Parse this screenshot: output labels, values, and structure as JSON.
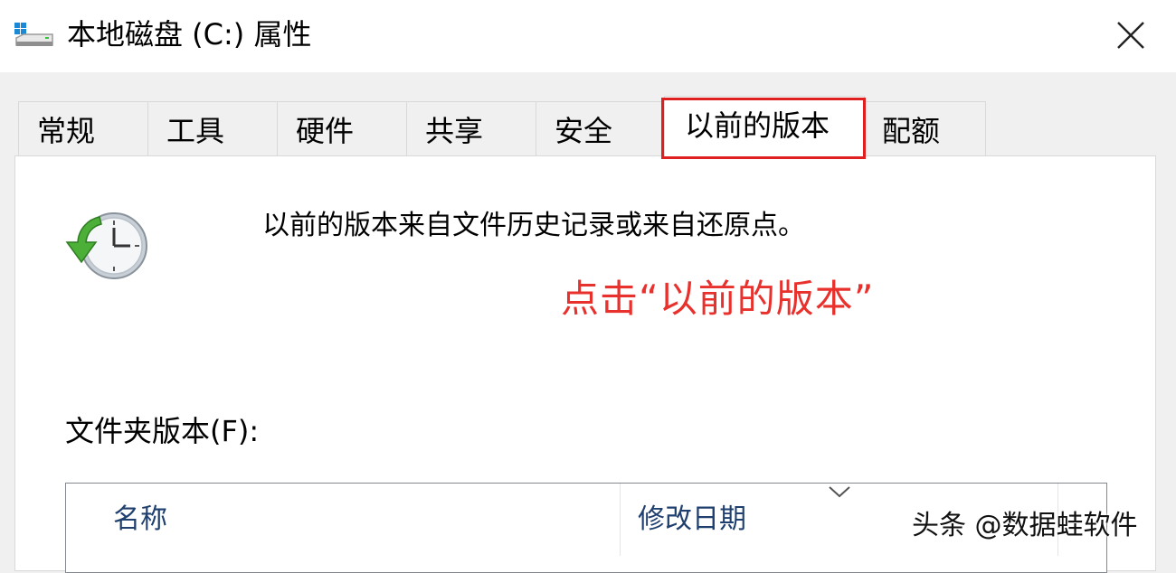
{
  "window": {
    "title": "本地磁盘 (C:) 属性",
    "icon": "drive-icon",
    "close_icon": "close-icon"
  },
  "tabs": [
    {
      "label": "常规"
    },
    {
      "label": "工具"
    },
    {
      "label": "硬件"
    },
    {
      "label": "共享"
    },
    {
      "label": "安全"
    },
    {
      "label": "以前的版本",
      "active": true
    },
    {
      "label": "配额"
    }
  ],
  "panel": {
    "icon": "restore-clock-icon",
    "description": "以前的版本来自文件历史记录或来自还原点。",
    "annotation": "点击“以前的版本”",
    "folder_versions_label": "文件夹版本(F):",
    "list_columns": [
      {
        "label": "名称"
      },
      {
        "label": "修改日期"
      }
    ]
  },
  "watermark": "头条 @数据蛙软件",
  "colors": {
    "highlight": "#e02020",
    "annotation": "#e8302c",
    "column_header": "#1f3f6f"
  }
}
